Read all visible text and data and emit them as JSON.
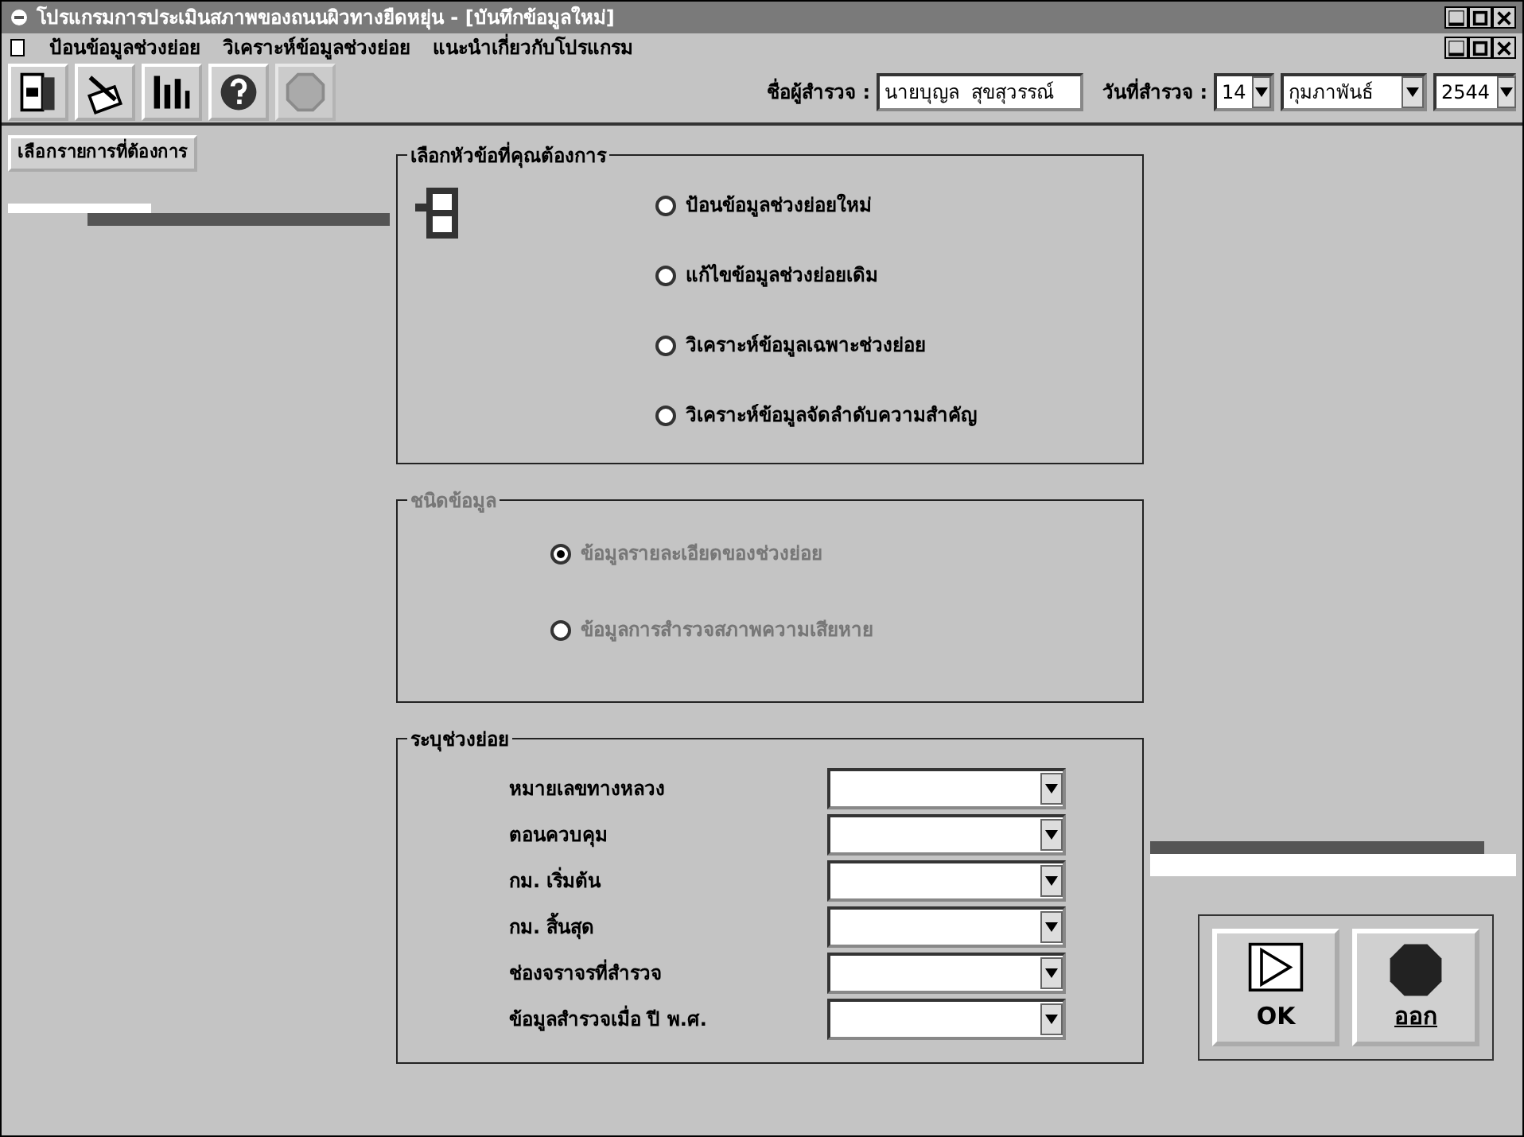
{
  "window": {
    "title": "โปรแกรมการประเมินสภาพของถนนผิวทางยืดหยุ่น - [บันทึกข้อมูลใหม่]"
  },
  "menu": [
    "ป้อนข้อมูลช่วงย่อย",
    "วิเคราะห์ข้อมูลช่วงย่อย",
    "แนะนำเกี่ยวกับโปรแกรม"
  ],
  "toolbar": {
    "tools": [
      {
        "kind": "report"
      },
      {
        "kind": "edit"
      },
      {
        "kind": "analyze"
      },
      {
        "kind": "help"
      },
      {
        "kind": "stop",
        "disabled": true
      }
    ],
    "surveyor_label": "ชื่อผู้สำรวจ :",
    "surveyor": "นายบุญล  สุขสุวรรณ์",
    "date_label": "วันที่สำรวจ :",
    "day": "14",
    "month": "กุมภาพันธ์",
    "year": "2544"
  },
  "side_button": "เลือกรายการที่ต้องการ",
  "topic_group": {
    "title": "เลือกหัวข้อที่คุณต้องการ",
    "options": [
      {
        "label": "ป้อนข้อมูลช่วงย่อยใหม่",
        "selected": false
      },
      {
        "label": "แก้ไขข้อมูลช่วงย่อยเดิม",
        "selected": false
      },
      {
        "label": "วิเคราะห์ข้อมูลเฉพาะช่วงย่อย",
        "selected": false
      },
      {
        "label": "วิเคราะห์ข้อมูลจัดลำดับความสำคัญ",
        "selected": false
      }
    ]
  },
  "type_group": {
    "title": "ชนิดข้อมูล",
    "disabled": true,
    "options": [
      {
        "label": "ข้อมูลรายละเอียดของช่วงย่อย",
        "selected": true
      },
      {
        "label": "ข้อมูลการสำรวจสภาพความเสียหาย",
        "selected": false
      }
    ]
  },
  "section_group": {
    "title": "ระบุช่วงย่อย",
    "fields": [
      {
        "label": "หมายเลขทางหลวง"
      },
      {
        "label": "ตอนควบคุม"
      },
      {
        "label": "กม. เริ่มต้น"
      },
      {
        "label": "กม. สิ้นสุด"
      },
      {
        "label": "ช่องจราจรที่สำรวจ"
      },
      {
        "label": "ข้อมูลสำรวจเมื่อ ปี พ.ศ."
      }
    ]
  },
  "buttons": [
    {
      "kind": "ok",
      "label": "OK"
    },
    {
      "kind": "exit",
      "label": "ออก"
    }
  ]
}
